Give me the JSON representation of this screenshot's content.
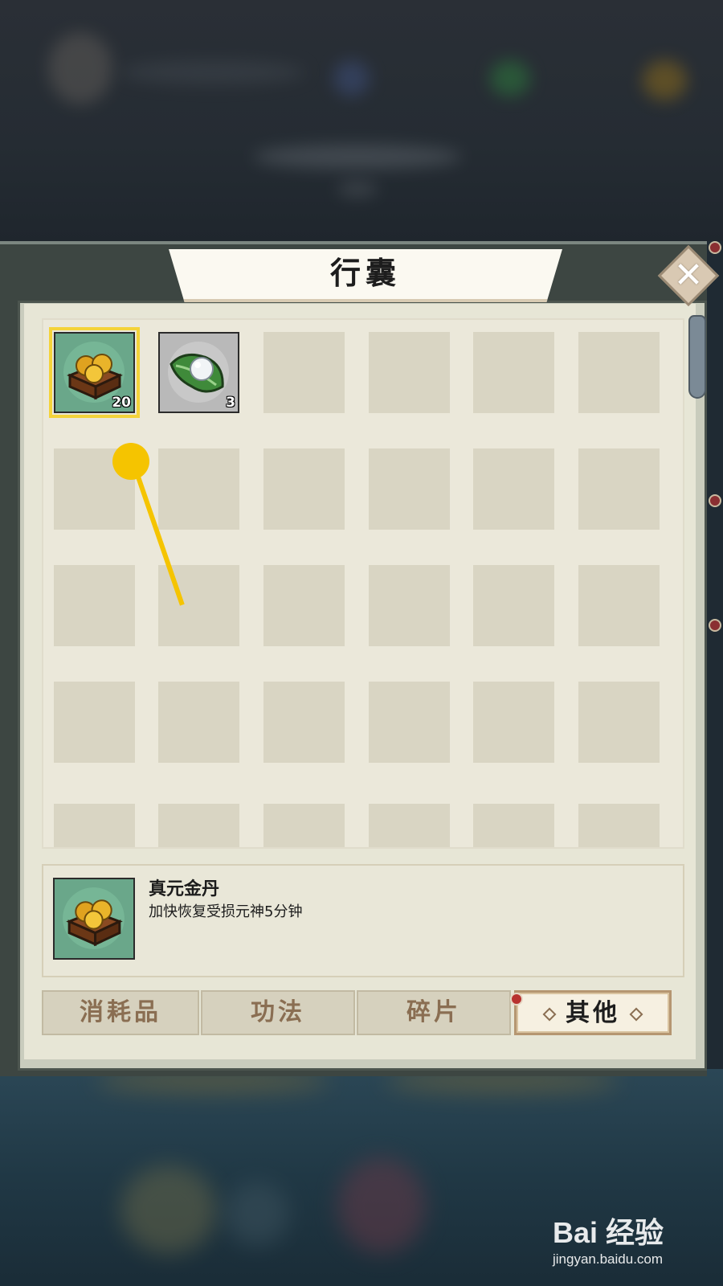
{
  "panel": {
    "title": "行囊",
    "close_icon": "close-x-icon"
  },
  "inventory": {
    "items": [
      {
        "name": "真元金丹",
        "icon": "golden-pills-box-icon",
        "quantity": "20",
        "selected": true
      },
      {
        "name": "",
        "icon": "pearl-on-leaf-icon",
        "quantity": "3",
        "selected": false
      }
    ]
  },
  "detail": {
    "name": "真元金丹",
    "description": "加快恢复受损元神5分钟",
    "icon": "golden-pills-box-icon"
  },
  "tabs": [
    {
      "label": "消耗品",
      "active": false
    },
    {
      "label": "功法",
      "active": false
    },
    {
      "label": "碎片",
      "active": false,
      "badge": true
    },
    {
      "label": "其他",
      "active": true
    }
  ],
  "watermark": {
    "logo": "Bai 经验",
    "url": "jingyan.baidu.com"
  },
  "colors": {
    "selected_outline": "#f4d33a",
    "item_bg_green": "#6aa78a",
    "pointer": "#f5c400",
    "badge_red": "#b8322f"
  }
}
